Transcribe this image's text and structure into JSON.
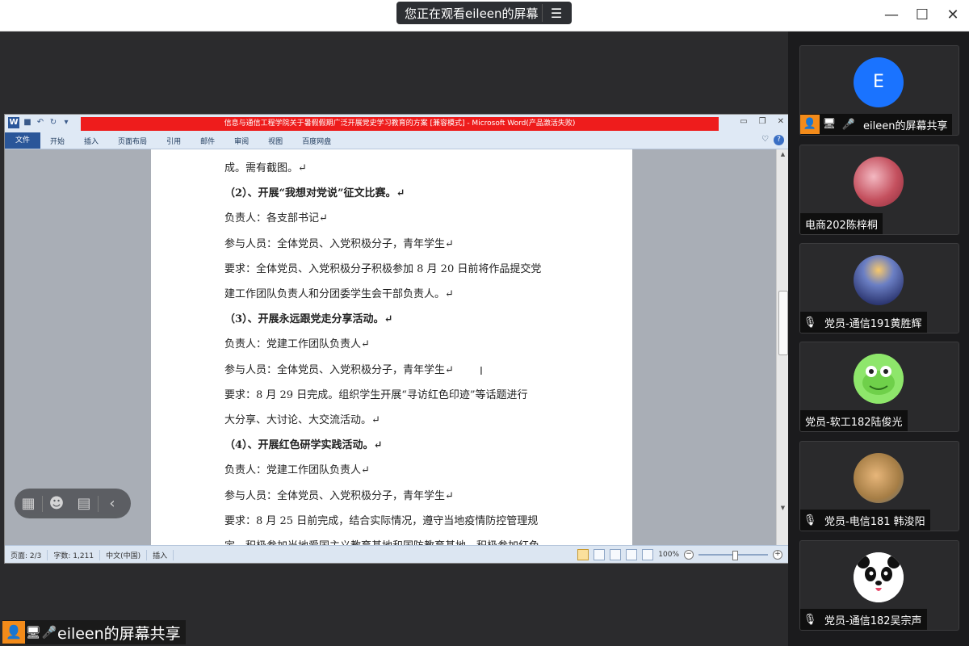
{
  "topbar": {
    "viewing_text": "您正在观看eileen的屏幕",
    "menu_icon": "menu-icon",
    "window_controls": [
      "minimize-icon",
      "maximize-icon",
      "close-icon"
    ]
  },
  "word": {
    "logo": "W",
    "title": "信息与通信工程学院关于暑假假期广泛开展党史学习教育的方案 [兼容模式] - Microsoft Word(产品激活失败)",
    "tabs": [
      "文件",
      "开始",
      "插入",
      "页面布局",
      "引用",
      "邮件",
      "审阅",
      "视图",
      "百度网盘"
    ],
    "active_tab": "文件",
    "lines": [
      {
        "text": "成。需有截图。↵",
        "bold": false
      },
      {
        "text": "（2）、开展“我想对党说”征文比赛。↵",
        "bold": true
      },
      {
        "text": "负责人：各支部书记↵",
        "bold": false
      },
      {
        "text": "参与人员：全体党员、入党积极分子，青年学生↵",
        "bold": false
      },
      {
        "text": "要求：全体党员、入党积极分子积极参加 8 月 20 日前将作品提交党",
        "bold": false
      },
      {
        "text": "建工作团队负责人和分团委学生会干部负责人。↵",
        "bold": false
      },
      {
        "text": "（3）、开展永远跟党走分享活动。↵",
        "bold": true
      },
      {
        "text": "负责人：党建工作团队负责人↵",
        "bold": false
      },
      {
        "text": "参与人员：全体党员、入党积极分子，青年学生↵",
        "bold": false
      },
      {
        "text": "要求：8 月 29 日完成。组织学生开展“寻访红色印迹”等话题进行",
        "bold": false
      },
      {
        "text": "大分享、大讨论、大交流活动。↵",
        "bold": false
      },
      {
        "text": "（4）、开展红色研学实践活动。↵",
        "bold": true
      },
      {
        "text": "负责人：党建工作团队负责人↵",
        "bold": false
      },
      {
        "text": "参与人员：全体党员、入党积极分子，青年学生↵",
        "bold": false
      },
      {
        "text": "要求：8 月 25 日前完成，结合实际情况，遵守当地疫情防控管理规",
        "bold": false
      },
      {
        "text": "定，积极参加当地爱国主义教育基地和国防教育基地，积极参加红色",
        "bold": false
      }
    ],
    "status": {
      "page": "页面: 2/3",
      "words": "字数: 1,211",
      "lang": "中文(中国)",
      "mode": "插入",
      "zoom": "100%"
    }
  },
  "reaction_bar": [
    "apps-icon",
    "emoji-icon",
    "chat-icon",
    "collapse-icon"
  ],
  "sharer_tag": {
    "name": "eileen的屏幕共享"
  },
  "participants": [
    {
      "name": "eileen的屏幕共享",
      "avatar_letter": "E",
      "muted": false,
      "sharing": true
    },
    {
      "name": "电商202陈梓桐",
      "muted": false,
      "sharing": false
    },
    {
      "name": "党员-通信191黄胜辉",
      "muted": true,
      "sharing": false
    },
    {
      "name": "党员-软工182陆俊光",
      "muted": false,
      "sharing": false
    },
    {
      "name": "党员-电信181 韩浚阳",
      "muted": true,
      "sharing": false
    },
    {
      "name": "党员-通信182吴宗声",
      "muted": true,
      "sharing": false
    }
  ]
}
